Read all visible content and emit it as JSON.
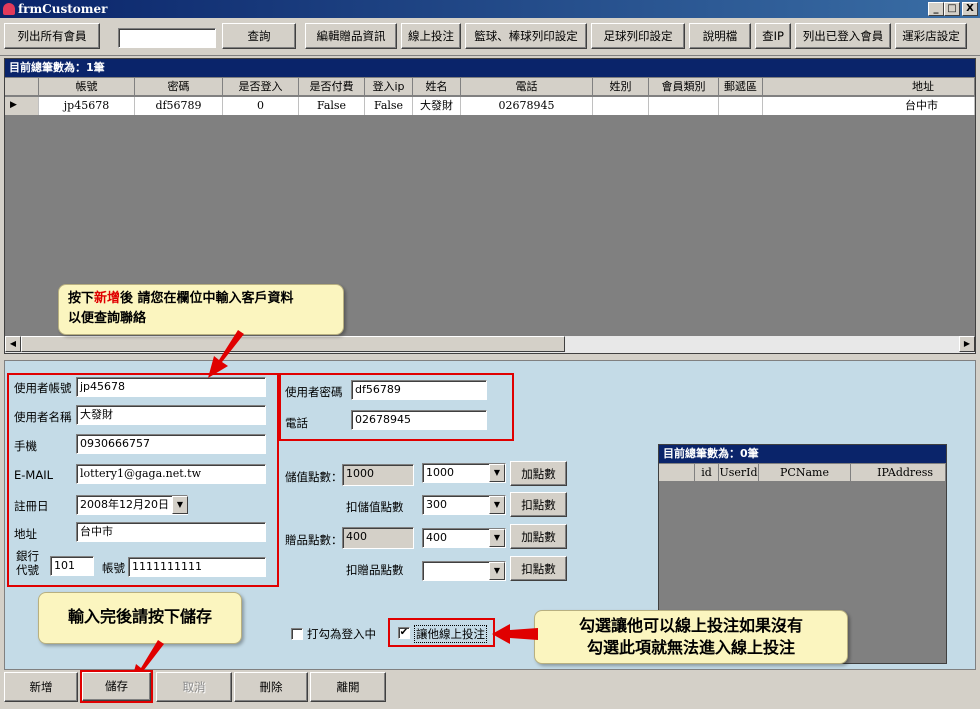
{
  "window": {
    "title": "frmCustomer",
    "controls": [
      "_",
      "□",
      "X"
    ]
  },
  "toolbar": {
    "list_all": "列出所有會員",
    "search_value": "",
    "query": "查詢",
    "edit_gift": "編輯贈品資訊",
    "online_bet": "線上投注",
    "basketball_print": "籃球、棒球列印設定",
    "football_print": "足球列印設定",
    "manual": "說明檔",
    "check_ip": "查IP",
    "list_logged_in": "列出已登入會員",
    "lottery_settings": "運彩店設定"
  },
  "customer_grid": {
    "caption": "目前總筆數為：1筆",
    "columns": [
      "帳號",
      "密碼",
      "是否登入",
      "是否付費",
      "登入ip",
      "姓名",
      "電話",
      "姓別",
      "會員類別",
      "郵遞區",
      "地址"
    ],
    "rows": [
      [
        "jp45678",
        "df56789",
        "0",
        "False",
        "False",
        "大發財",
        "02678945",
        "",
        "",
        "",
        "台中市"
      ]
    ]
  },
  "callouts": {
    "top_line1_pre": "按下",
    "top_line1_highlight": "新增",
    "top_line1_post": "後 請您在欄位中輸入客戶資料",
    "top_line2": "以便查詢聯絡",
    "save": "輸入完後請按下儲存",
    "online_line1": "勾選讓他可以線上投注如果沒有",
    "online_line2": "勾選此項就無法進入線上投注"
  },
  "form": {
    "account_label": "使用者帳號",
    "account": "jp45678",
    "name_label": "使用者名稱",
    "name": "大發財",
    "mobile_label": "手機",
    "mobile": "0930666757",
    "email_label": "E-MAIL",
    "email": "lottery1@gaga.net.tw",
    "regdate_label": "註冊日",
    "regdate": "2008年12月20日",
    "address_label": "地址",
    "address": "台中市",
    "bank_code_label1": "銀行",
    "bank_code_label2": "代號",
    "bank_code": "101",
    "bank_acct_label": "帳號",
    "bank_acct": "1111111111",
    "password_label": "使用者密碼",
    "password": "df56789",
    "phone_label": "電話",
    "phone": "02678945",
    "stored_points_label": "儲值點數：",
    "stored_points": "1000",
    "stored_select": "1000",
    "add_points": "加點數",
    "deduct_stored_label": "扣儲值點數",
    "deduct_stored_select": "300",
    "deduct_points": "扣點數",
    "gift_points_label": "贈品點數：",
    "gift_points": "400",
    "gift_select": "400",
    "add_gift": "加點數",
    "deduct_gift_label": "扣贈品點數",
    "deduct_gift_select": "",
    "deduct_gift": "扣點數",
    "logged_in_label": "打勾為登入中",
    "online_bet_label": "讓他線上投注"
  },
  "session_grid": {
    "caption": "目前總筆數為：0筆",
    "columns": [
      "id",
      "UserId",
      "PCName",
      "IPAddress"
    ]
  },
  "bottom": {
    "add": "新增",
    "save": "儲存",
    "cancel": "取消",
    "delete": "刪除",
    "close": "離開"
  },
  "colors": {
    "title_bar": "#0a246a",
    "panel": "#c4dbe7",
    "highlight_red": "#e00000",
    "callout_bg": "#fbf5bf"
  }
}
